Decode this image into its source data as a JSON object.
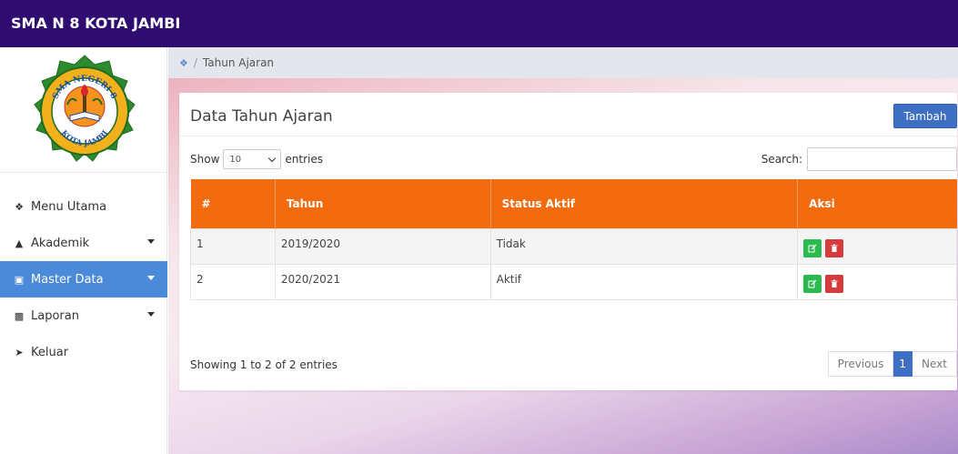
{
  "app": {
    "title": "SMA N 8 KOTA JAMBI"
  },
  "logo": {
    "top_text": "SMA NEGERI 8",
    "bottom_text": "KOTA JAMBI",
    "icon": "school-emblem"
  },
  "sidebar": {
    "items": [
      {
        "label": "Menu Utama",
        "icon": "home-icon",
        "active": false,
        "has_caret": false
      },
      {
        "label": "Akademik",
        "icon": "institution-icon",
        "active": false,
        "has_caret": true
      },
      {
        "label": "Master Data",
        "icon": "database-icon",
        "active": true,
        "has_caret": true
      },
      {
        "label": "Laporan",
        "icon": "print-icon",
        "active": false,
        "has_caret": true
      },
      {
        "label": "Keluar",
        "icon": "logout-icon",
        "active": false,
        "has_caret": false
      }
    ]
  },
  "breadcrumb": {
    "current": "Tahun Ajaran"
  },
  "card": {
    "title": "Data Tahun Ajaran",
    "add_button": "Tambah"
  },
  "table_controls": {
    "show_label": "Show",
    "page_length": "10",
    "entries_label": "entries",
    "search_label": "Search:",
    "search_value": ""
  },
  "table": {
    "columns": [
      "#",
      "Tahun",
      "Status Aktif",
      "Aksi"
    ],
    "rows": [
      {
        "no": "1",
        "tahun": "2019/2020",
        "status": "Tidak"
      },
      {
        "no": "2",
        "tahun": "2020/2021",
        "status": "Aktif"
      }
    ]
  },
  "footer": {
    "info": "Showing 1 to 2 of 2 entries",
    "previous": "Previous",
    "page": "1",
    "next": "Next"
  },
  "colors": {
    "topbar": "#2f0c70",
    "active_menu": "#4a8ad8",
    "table_header": "#f26b0f",
    "primary_button": "#3f6fc2",
    "edit_button": "#2bb950",
    "delete_button": "#d73a3a"
  }
}
